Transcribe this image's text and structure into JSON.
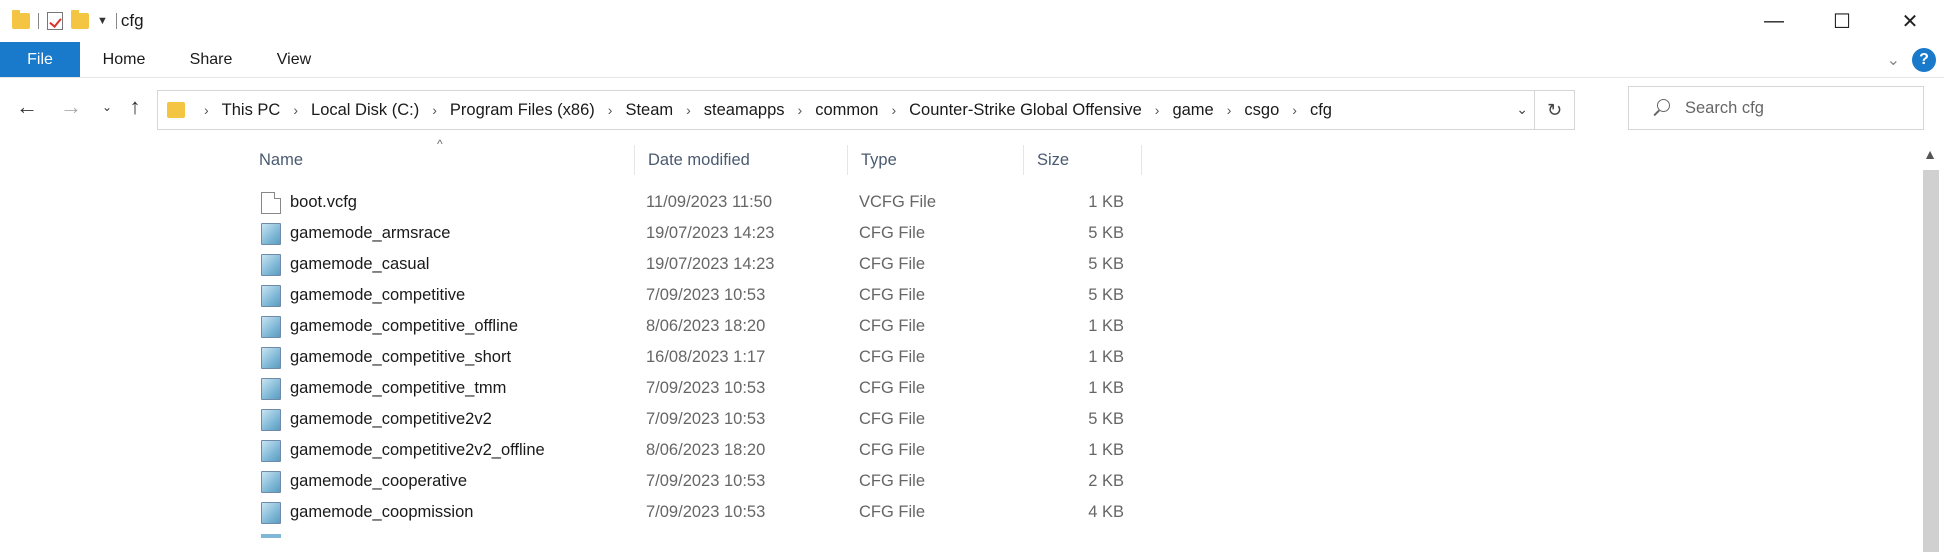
{
  "window": {
    "title": "cfg",
    "minimize": "—",
    "maximize": "☐",
    "close": "✕"
  },
  "ribbon": {
    "tabs": [
      "File",
      "Home",
      "Share",
      "View"
    ],
    "expand_icon": "chevron-down-icon",
    "help_label": "?"
  },
  "nav": {
    "back": "←",
    "forward": "→",
    "recent": "⌄",
    "up": "↑",
    "breadcrumbs": [
      "This PC",
      "Local Disk (C:)",
      "Program Files (x86)",
      "Steam",
      "steamapps",
      "common",
      "Counter-Strike Global Offensive",
      "game",
      "csgo",
      "cfg"
    ],
    "separator": "›",
    "dropdown": "⌄",
    "refresh": "↻",
    "search_placeholder": "Search cfg"
  },
  "columns": {
    "name": "Name",
    "date": "Date modified",
    "type": "Type",
    "size": "Size"
  },
  "files": [
    {
      "name": "boot.vcfg",
      "date": "11/09/2023 11:50",
      "type": "VCFG File",
      "size": "1 KB",
      "icon": "plain-file-icon"
    },
    {
      "name": "gamemode_armsrace",
      "date": "19/07/2023 14:23",
      "type": "CFG File",
      "size": "5 KB",
      "icon": "cfg-file-icon"
    },
    {
      "name": "gamemode_casual",
      "date": "19/07/2023 14:23",
      "type": "CFG File",
      "size": "5 KB",
      "icon": "cfg-file-icon"
    },
    {
      "name": "gamemode_competitive",
      "date": "7/09/2023 10:53",
      "type": "CFG File",
      "size": "5 KB",
      "icon": "cfg-file-icon"
    },
    {
      "name": "gamemode_competitive_offline",
      "date": "8/06/2023 18:20",
      "type": "CFG File",
      "size": "1 KB",
      "icon": "cfg-file-icon"
    },
    {
      "name": "gamemode_competitive_short",
      "date": "16/08/2023 1:17",
      "type": "CFG File",
      "size": "1 KB",
      "icon": "cfg-file-icon"
    },
    {
      "name": "gamemode_competitive_tmm",
      "date": "7/09/2023 10:53",
      "type": "CFG File",
      "size": "1 KB",
      "icon": "cfg-file-icon"
    },
    {
      "name": "gamemode_competitive2v2",
      "date": "7/09/2023 10:53",
      "type": "CFG File",
      "size": "5 KB",
      "icon": "cfg-file-icon"
    },
    {
      "name": "gamemode_competitive2v2_offline",
      "date": "8/06/2023 18:20",
      "type": "CFG File",
      "size": "1 KB",
      "icon": "cfg-file-icon"
    },
    {
      "name": "gamemode_cooperative",
      "date": "7/09/2023 10:53",
      "type": "CFG File",
      "size": "2 KB",
      "icon": "cfg-file-icon"
    },
    {
      "name": "gamemode_coopmission",
      "date": "7/09/2023 10:53",
      "type": "CFG File",
      "size": "4 KB",
      "icon": "cfg-file-icon"
    }
  ],
  "colors": {
    "accent": "#1979ca",
    "folder": "#f4c542"
  }
}
